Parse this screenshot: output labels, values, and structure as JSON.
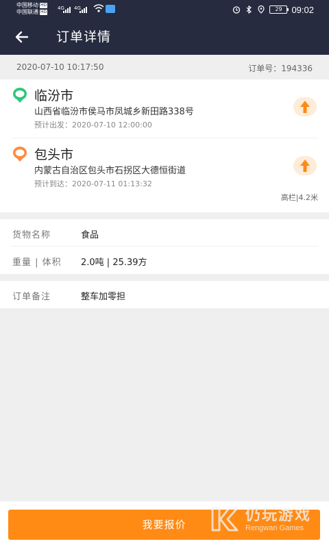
{
  "status_bar": {
    "carrier1": "中国移动",
    "carrier2": "中国联通",
    "hd": "HD",
    "net1": "4G",
    "net2": "4G",
    "battery": "29",
    "time": "09:02"
  },
  "header": {
    "title": "订单详情",
    "back_icon": "arrow-left-icon"
  },
  "order_meta": {
    "datetime": "2020-07-10 10:17:50",
    "order_no": "订单号：194336"
  },
  "route": {
    "origin": {
      "city": "临汾市",
      "address": "山西省临汾市侯马市凤城乡新田路338号",
      "time": "预计出发：2020-07-10 12:00:00",
      "pin_color": "#2ec77e"
    },
    "destination": {
      "city": "包头市",
      "address": "内蒙古自治区包头市石拐区大德恒街道",
      "time": "预计到达：2020-07-11 01:13:32",
      "pin_color": "#ff8a3d"
    },
    "truck": "高栏|4.2米"
  },
  "goods": {
    "name_label": "货物名称",
    "name_value": "食品",
    "weight_label": "重量 | 体积",
    "weight_value": "2.0吨 | 25.39方"
  },
  "remark": {
    "label": "订单备注",
    "value": "整车加零担"
  },
  "action": {
    "quote_button": "我要报价"
  },
  "watermark": {
    "name": "仍玩游戏",
    "sub": "Rengwan Games"
  },
  "colors": {
    "header_bg": "#262b3f",
    "accent": "#ff8a14"
  }
}
